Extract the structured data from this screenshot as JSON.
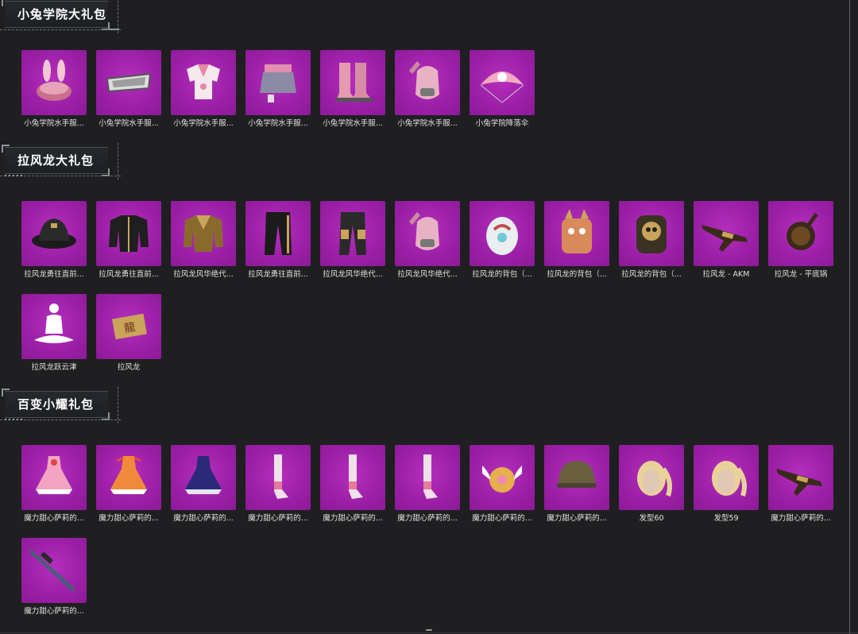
{
  "sections": [
    {
      "title": "小兔学院大礼包",
      "items": [
        {
          "label": "小兔学院水手服...",
          "icon": "bunny-hat-icon"
        },
        {
          "label": "小兔学院水手服...",
          "icon": "glasses-icon"
        },
        {
          "label": "小兔学院水手服...",
          "icon": "sailor-top-icon"
        },
        {
          "label": "小兔学院水手服...",
          "icon": "skirt-icon"
        },
        {
          "label": "小兔学院水手服...",
          "icon": "boots-icon"
        },
        {
          "label": "小兔学院水手服...",
          "icon": "gloves-icon"
        },
        {
          "label": "小兔学院降落伞",
          "icon": "parachute-icon"
        }
      ]
    },
    {
      "title": "拉风龙大礼包",
      "items": [
        {
          "label": "拉风龙勇往直前...",
          "icon": "bucket-hat-icon"
        },
        {
          "label": "拉风龙勇往直前...",
          "icon": "jacket-icon"
        },
        {
          "label": "拉风龙风华绝代...",
          "icon": "gold-jacket-icon"
        },
        {
          "label": "拉风龙勇往直前...",
          "icon": "pants-icon"
        },
        {
          "label": "拉风龙风华绝代...",
          "icon": "cargo-pants-icon"
        },
        {
          "label": "拉风龙风华绝代...",
          "icon": "gloves-icon"
        },
        {
          "label": "拉风龙的背包（...",
          "icon": "egg-backpack-icon"
        },
        {
          "label": "拉风龙的背包（...",
          "icon": "dragon-backpack-icon"
        },
        {
          "label": "拉风龙的背包（...",
          "icon": "skull-backpack-icon"
        },
        {
          "label": "拉风龙 - AKM",
          "icon": "rifle-icon"
        },
        {
          "label": "拉风龙 - 平底锅",
          "icon": "pan-icon"
        },
        {
          "label": "拉风龙跃云津",
          "icon": "meditation-emote-icon"
        },
        {
          "label": "拉风龙",
          "icon": "dragon-plaque-icon"
        }
      ]
    },
    {
      "title": "百变小耀礼包",
      "items": [
        {
          "label": "魔力甜心萨莉的...",
          "icon": "pink-dress-icon"
        },
        {
          "label": "魔力甜心萨莉的...",
          "icon": "orange-dress-icon"
        },
        {
          "label": "魔力甜心萨莉的...",
          "icon": "navy-dress-icon"
        },
        {
          "label": "魔力甜心萨莉的...",
          "icon": "stockings-icon"
        },
        {
          "label": "魔力甜心萨莉的...",
          "icon": "stockings-icon"
        },
        {
          "label": "魔力甜心萨莉的...",
          "icon": "stockings-icon"
        },
        {
          "label": "魔力甜心萨莉的...",
          "icon": "winged-backpack-icon"
        },
        {
          "label": "魔力甜心萨莉的...",
          "icon": "helmet-icon"
        },
        {
          "label": "发型60",
          "icon": "hairstyle-icon"
        },
        {
          "label": "发型59",
          "icon": "hairstyle-icon"
        },
        {
          "label": "魔力甜心萨莉的...",
          "icon": "rifle-icon"
        },
        {
          "label": "魔力甜心萨莉的...",
          "icon": "sniper-rifle-icon"
        }
      ]
    }
  ],
  "colors": {
    "background": "#1f1f21",
    "tile": "#9b1fa6",
    "label": "#e0e0e0",
    "header_text": "#ffffff"
  }
}
